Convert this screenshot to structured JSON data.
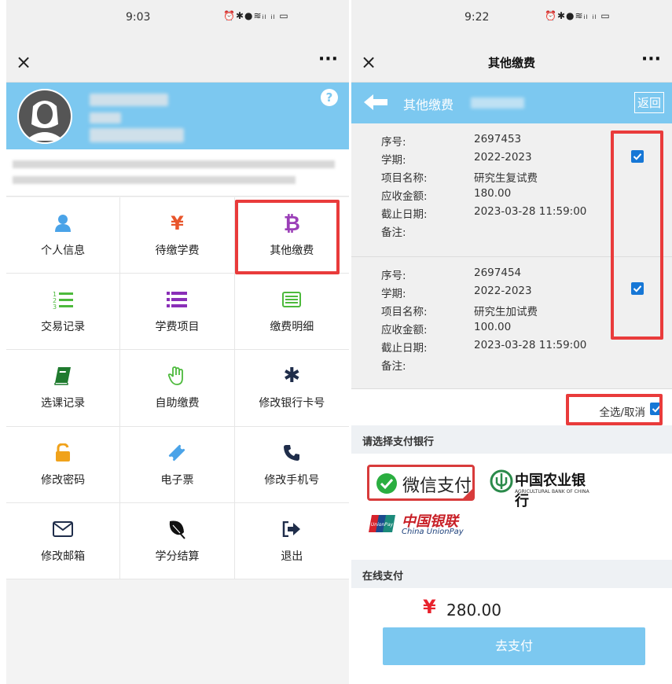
{
  "left": {
    "status_time": "9:03",
    "status_icons": "⏰✱●≋ᵢₗ ᵢₗ ▭",
    "close_glyph": "×",
    "more_glyph": "···",
    "menu": [
      {
        "label": "个人信息",
        "icon": "user-icon",
        "color": "#4aa3e8"
      },
      {
        "label": "待缴学费",
        "icon": "yen-icon",
        "color": "#e8552b"
      },
      {
        "label": "其他缴费",
        "icon": "bitcoin-icon",
        "color": "#9b3fb8"
      },
      {
        "label": "交易记录",
        "icon": "numbered-list-icon",
        "color": "#4dba3c"
      },
      {
        "label": "学费项目",
        "icon": "list-icon",
        "color": "#8a2fb8"
      },
      {
        "label": "缴费明细",
        "icon": "table-icon",
        "color": "#4dba3c"
      },
      {
        "label": "选课记录",
        "icon": "book-icon",
        "color": "#1f7a2e"
      },
      {
        "label": "自助缴费",
        "icon": "hand-icon",
        "color": "#4dba3c"
      },
      {
        "label": "修改银行卡号",
        "icon": "gear-icon",
        "color": "#1f2d4a"
      },
      {
        "label": "修改密码",
        "icon": "unlock-icon",
        "color": "#f0a21b"
      },
      {
        "label": "电子票",
        "icon": "ticket-icon",
        "color": "#4aa3e8"
      },
      {
        "label": "修改手机号",
        "icon": "phone-icon",
        "color": "#1f2d4a"
      },
      {
        "label": "修改邮箱",
        "icon": "envelope-icon",
        "color": "#1f2d4a"
      },
      {
        "label": "学分结算",
        "icon": "leaf-icon",
        "color": "#111111"
      },
      {
        "label": "退出",
        "icon": "logout-icon",
        "color": "#1f2d4a"
      }
    ]
  },
  "right": {
    "status_time": "9:22",
    "status_icons": "⏰✱●≋ᵢₗ ᵢₗ ▭",
    "close_glyph": "×",
    "more_glyph": "···",
    "nav_title": "其他缴费",
    "sub_title": "其他缴费",
    "back_label": "返回",
    "field_labels": [
      "序号:",
      "学期:",
      "项目名称:",
      "应收金额:",
      "截止日期:",
      "备注:"
    ],
    "fees": [
      {
        "id": "2697453",
        "term": "2022-2023",
        "name": "研究生复试费",
        "amount": "180.00",
        "deadline": "2023-03-28 11:59:00",
        "note": "",
        "checked": true
      },
      {
        "id": "2697454",
        "term": "2022-2023",
        "name": "研究生加试费",
        "amount": "100.00",
        "deadline": "2023-03-28 11:59:00",
        "note": "",
        "checked": true
      }
    ],
    "select_all_label": "全选/取消",
    "bank_section_title": "请选择支付银行",
    "bank_wechat": "微信支付",
    "bank_abc_cn": "中国农业银行",
    "bank_abc_en": "AGRICULTURAL BANK OF CHINA",
    "bank_unionpay_cn": "中国银联",
    "bank_unionpay_en": "China UnionPay",
    "online_pay_title": "在线支付",
    "currency_symbol": "¥",
    "total_amount": "280.00",
    "pay_button": "去支付"
  },
  "colors": {
    "header_blue": "#7cc8f0",
    "highlight_red": "#e93b3b",
    "checkbox_blue": "#1677d6"
  }
}
